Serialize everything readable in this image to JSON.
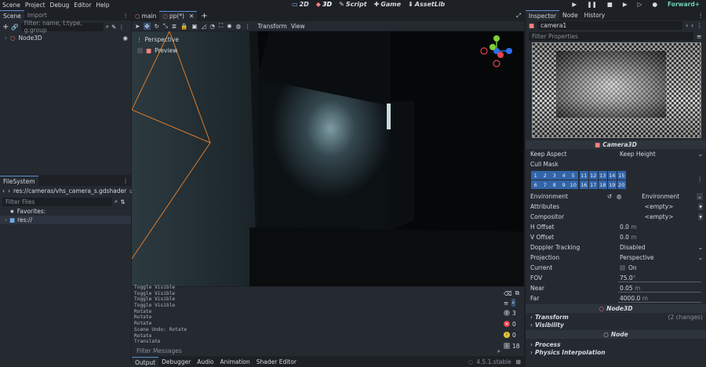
{
  "menu": [
    "Scene",
    "Project",
    "Debug",
    "Editor",
    "Help"
  ],
  "workspaces": [
    "2D",
    "3D",
    "Script",
    "Game",
    "AssetLib"
  ],
  "renderer": "Forward+",
  "scene_dock": {
    "tabs": [
      "Scene",
      "Import"
    ],
    "filter_placeholder": "Filter: name, t:type, g:group",
    "tree": [
      {
        "label": "Node3D"
      }
    ]
  },
  "filesystem": {
    "title": "FileSystem",
    "path": "res://cameras/vhs_camera_s.gdshader",
    "filter_placeholder": "Filter Files",
    "items": [
      "Favorites:",
      "res://"
    ]
  },
  "editor_tabs": [
    {
      "label": "main"
    },
    {
      "label": "pp(*)"
    }
  ],
  "viewport": {
    "menus": [
      "Transform",
      "View"
    ],
    "perspective_label": "Perspective",
    "preview_label": "Preview"
  },
  "output": {
    "lines": [
      "Toggle Visible",
      "Toggle Visible",
      "Toggle Visible",
      "Toggle Visible",
      "Rotate",
      "Rotate",
      "Rotate",
      "Scene Undo: Rotate",
      "Rotate",
      "Translate"
    ],
    "filter_placeholder": "Filter Messages",
    "counts": {
      "log": "3",
      "error": "0",
      "warning": "0",
      "message": "18"
    }
  },
  "bottom_tabs": [
    "Output",
    "Debugger",
    "Audio",
    "Animation",
    "Shader Editor"
  ],
  "version": "4.5.1.stable",
  "inspector": {
    "tabs": [
      "Inspector",
      "Node",
      "History"
    ],
    "object_name": "camera1",
    "filter_placeholder": "Filter Properties",
    "class_header": "Camera3D",
    "keep_aspect": {
      "label": "Keep Aspect",
      "value": "Keep Height"
    },
    "cull_mask_label": "Cull Mask",
    "cull_mask_row1": [
      "1",
      "2",
      "3",
      "4",
      "5",
      "11",
      "12",
      "13",
      "14",
      "15"
    ],
    "cull_mask_row2": [
      "6",
      "7",
      "8",
      "9",
      "10",
      "16",
      "17",
      "18",
      "19",
      "20"
    ],
    "environment": {
      "label": "Environment",
      "value": "Environment"
    },
    "attributes": {
      "label": "Attributes",
      "value": "<empty>"
    },
    "compositor": {
      "label": "Compositor",
      "value": "<empty>"
    },
    "h_offset": {
      "label": "H Offset",
      "value": "0.0",
      "unit": "m"
    },
    "v_offset": {
      "label": "V Offset",
      "value": "0.0",
      "unit": "m"
    },
    "doppler": {
      "label": "Doppler Tracking",
      "value": "Disabled"
    },
    "projection": {
      "label": "Projection",
      "value": "Perspective"
    },
    "current": {
      "label": "Current",
      "value": "On"
    },
    "fov": {
      "label": "FOV",
      "value": "75.0",
      "unit": "°"
    },
    "near": {
      "label": "Near",
      "value": "0.05",
      "unit": "m"
    },
    "far": {
      "label": "Far",
      "value": "4000.0",
      "unit": "m"
    },
    "node3d_header": "Node3D",
    "transform": {
      "label": "Transform",
      "note": "(2 changes)"
    },
    "visibility_label": "Visibility",
    "node_header": "Node",
    "process_label": "Process",
    "physics_label": "Physics Interpolation"
  },
  "colors": {
    "accent": "#5e8fd0",
    "cull": "#3264a8",
    "error": "#e0454b",
    "warning": "#e8c43a",
    "camera": "#fc7f7f"
  }
}
